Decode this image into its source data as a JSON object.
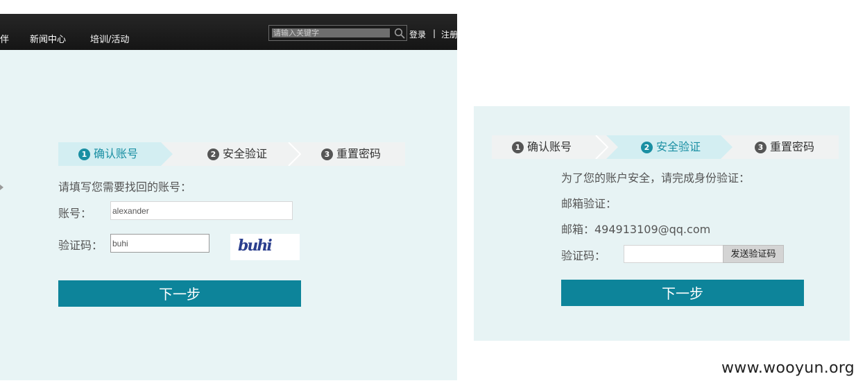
{
  "left": {
    "nav": {
      "partner": "伴",
      "news": "新闻中心",
      "training": "培训/活动"
    },
    "search": {
      "placeholder": "请输入关键字",
      "icon": "search-icon"
    },
    "auth": {
      "login": "登录",
      "divider": "|",
      "register": "注册"
    },
    "stepper": {
      "steps": [
        {
          "num": "1",
          "label": "确认账号",
          "active": true
        },
        {
          "num": "2",
          "label": "安全验证",
          "active": false
        },
        {
          "num": "3",
          "label": "重置密码",
          "active": false
        }
      ]
    },
    "form": {
      "instruction": "请填写您需要找回的账号：",
      "account_label": "账号：",
      "account_value": "alexander",
      "captcha_label": "验证码：",
      "captcha_value": "buhi",
      "captcha_image_text": "buhi",
      "next_button": "下一步"
    }
  },
  "right": {
    "stepper": {
      "steps": [
        {
          "num": "1",
          "label": "确认账号",
          "active": false
        },
        {
          "num": "2",
          "label": "安全验证",
          "active": true
        },
        {
          "num": "3",
          "label": "重置密码",
          "active": false
        }
      ]
    },
    "form": {
      "instruction": "为了您的账户安全，请完成身份验证：",
      "email_verify_label": "邮箱验证：",
      "email_address": "邮箱：494913109@qq.com",
      "captcha_label": "验证码：",
      "captcha_value": "",
      "send_code_button": "发送验证码",
      "next_button": "下一步"
    }
  },
  "watermark": "www.wooyun.org",
  "colors": {
    "accent": "#0d849a",
    "active_step_text": "#1a8fa3",
    "panel_bg": "#e8f4f5",
    "topbar_bg": "#1f1f1f"
  }
}
